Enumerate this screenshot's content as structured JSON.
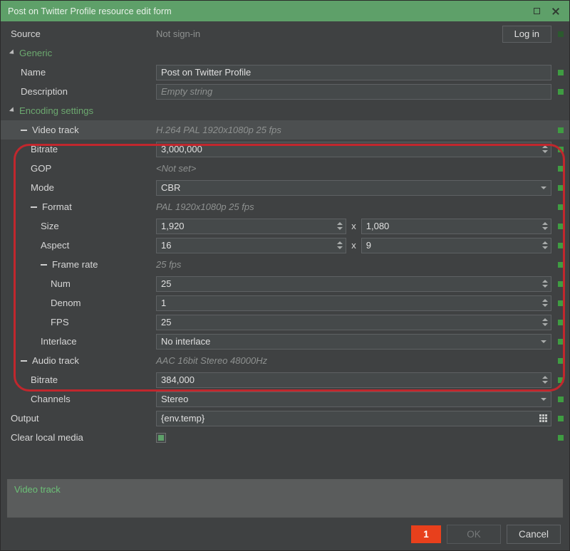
{
  "window": {
    "title": "Post on Twitter Profile resource edit form",
    "maximize_icon": "maximize-icon",
    "close_icon": "close-icon",
    "titlebar_color": "#5ea069"
  },
  "form": {
    "source": {
      "label": "Source",
      "value": "Not sign-in",
      "login_button": "Log in"
    },
    "generic_group": {
      "label": "Generic"
    },
    "name": {
      "label": "Name",
      "value": "Post on Twitter Profile"
    },
    "description": {
      "label": "Description",
      "placeholder": "Empty string"
    },
    "encoding_group": {
      "label": "Encoding settings"
    },
    "video_track": {
      "label": "Video track",
      "summary": "H.264 PAL 1920x1080p 25 fps"
    },
    "video_bitrate": {
      "label": "Bitrate",
      "value": "3,000,000"
    },
    "gop": {
      "label": "GOP",
      "value": "<Not set>"
    },
    "mode": {
      "label": "Mode",
      "value": "CBR"
    },
    "format": {
      "label": "Format",
      "summary": "PAL 1920x1080p 25 fps"
    },
    "size": {
      "label": "Size",
      "width": "1,920",
      "height": "1,080",
      "separator": "x"
    },
    "aspect": {
      "label": "Aspect",
      "num": "16",
      "den": "9",
      "separator": "x"
    },
    "frame_rate": {
      "label": "Frame rate",
      "summary": "25 fps"
    },
    "num": {
      "label": "Num",
      "value": "25"
    },
    "denom": {
      "label": "Denom",
      "value": "1"
    },
    "fps": {
      "label": "FPS",
      "value": "25"
    },
    "interlace": {
      "label": "Interlace",
      "value": "No interlace"
    },
    "audio_track": {
      "label": "Audio track",
      "summary": "AAC 16bit Stereo 48000Hz"
    },
    "audio_bitrate": {
      "label": "Bitrate",
      "value": "384,000"
    },
    "channels": {
      "label": "Channels",
      "value": "Stereo"
    },
    "output": {
      "label": "Output",
      "value": "{env.temp}",
      "browse_icon": "grid-browse-icon"
    },
    "clear_local_media": {
      "label": "Clear local media",
      "checked": true
    }
  },
  "message_panel": {
    "text": "Video track",
    "text_color": "#6cc077"
  },
  "footer": {
    "error_count": "1",
    "error_badge_color": "#e8401c",
    "ok_label": "OK",
    "ok_disabled": true,
    "cancel_label": "Cancel"
  },
  "annotation": {
    "color": "#c1272d",
    "shape": "rounded-rectangle"
  }
}
